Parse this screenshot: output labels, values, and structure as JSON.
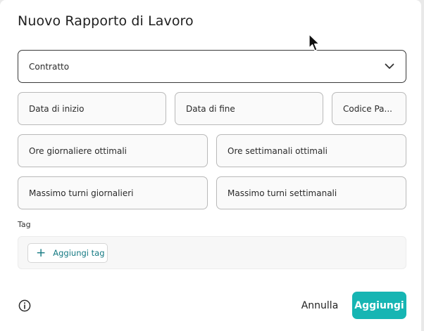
{
  "dialog": {
    "title": "Nuovo Rapporto di Lavoro"
  },
  "form": {
    "contract_label": "Contratto",
    "start_date_label": "Data di inizio",
    "end_date_label": "Data di fine",
    "payroll_code_label": "Codice Pa...",
    "optimal_daily_hours_label": "Ore giornaliere ottimali",
    "optimal_weekly_hours_label": "Ore settimanali ottimali",
    "max_daily_shifts_label": "Massimo turni giornalieri",
    "max_weekly_shifts_label": "Massimo turni settimanali"
  },
  "tags": {
    "label": "Tag",
    "add_button": "Aggiungi tag"
  },
  "footer": {
    "cancel_label": "Annulla",
    "submit_label": "Aggiungi"
  },
  "icons": {
    "contract_dropdown": "chevron-down-icon",
    "add_tag": "plus-icon",
    "info": "info-icon",
    "pointer": "mouse-cursor-icon"
  },
  "colors": {
    "accent": "#16b5b3",
    "accent_text": "#157a83",
    "field_border": "#b9b9b9"
  }
}
